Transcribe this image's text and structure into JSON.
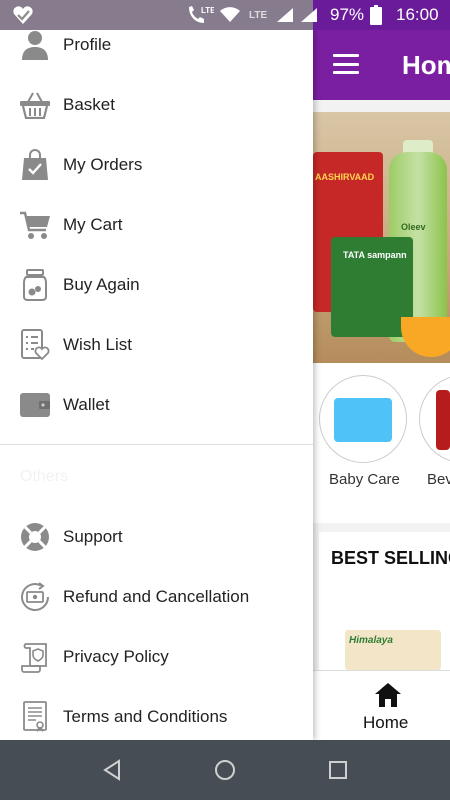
{
  "status_bar": {
    "lte_label_1": "LTE",
    "lte_label_2": "LTE",
    "battery_percent": "97%",
    "time": "16:00",
    "icons": [
      "app-notification-icon",
      "call-icon",
      "wifi-icon",
      "signal-icon",
      "signal-icon",
      "battery-icon"
    ]
  },
  "app": {
    "title": "Home",
    "banner": {
      "brand_1": "AASHIRVAAD",
      "brand_2": "TATA sampann",
      "brand_3": "Oleev"
    },
    "categories": [
      {
        "label": "Baby Care",
        "icon": "diaper-pack-image"
      },
      {
        "label": "Bev",
        "icon": "bottle-image"
      }
    ],
    "best_selling_title": "BEST SELLING",
    "best_selling_product_brand": "Himalaya",
    "bottom_nav": {
      "home_label": "Home"
    }
  },
  "drawer": {
    "menu_items": [
      {
        "label": "Profile",
        "icon": "profile-icon"
      },
      {
        "label": "Basket",
        "icon": "basket-icon"
      },
      {
        "label": "My Orders",
        "icon": "shopping-bag-icon"
      },
      {
        "label": "My Cart",
        "icon": "cart-icon"
      },
      {
        "label": "Buy Again",
        "icon": "jar-icon"
      },
      {
        "label": "Wish List",
        "icon": "wishlist-icon"
      },
      {
        "label": "Wallet",
        "icon": "wallet-icon"
      }
    ],
    "section_header": "Others",
    "other_items": [
      {
        "label": "Support",
        "icon": "lifebuoy-icon"
      },
      {
        "label": "Refund and Cancellation",
        "icon": "refund-icon"
      },
      {
        "label": "Privacy Policy",
        "icon": "privacy-scroll-icon"
      },
      {
        "label": "Terms and Conditions",
        "icon": "terms-document-icon"
      }
    ]
  },
  "colors": {
    "accent": "#7b1fa2",
    "drawer_bg": "#ffffff",
    "nav_bar": "#464d54",
    "icon_gray": "#8a8a8a"
  }
}
